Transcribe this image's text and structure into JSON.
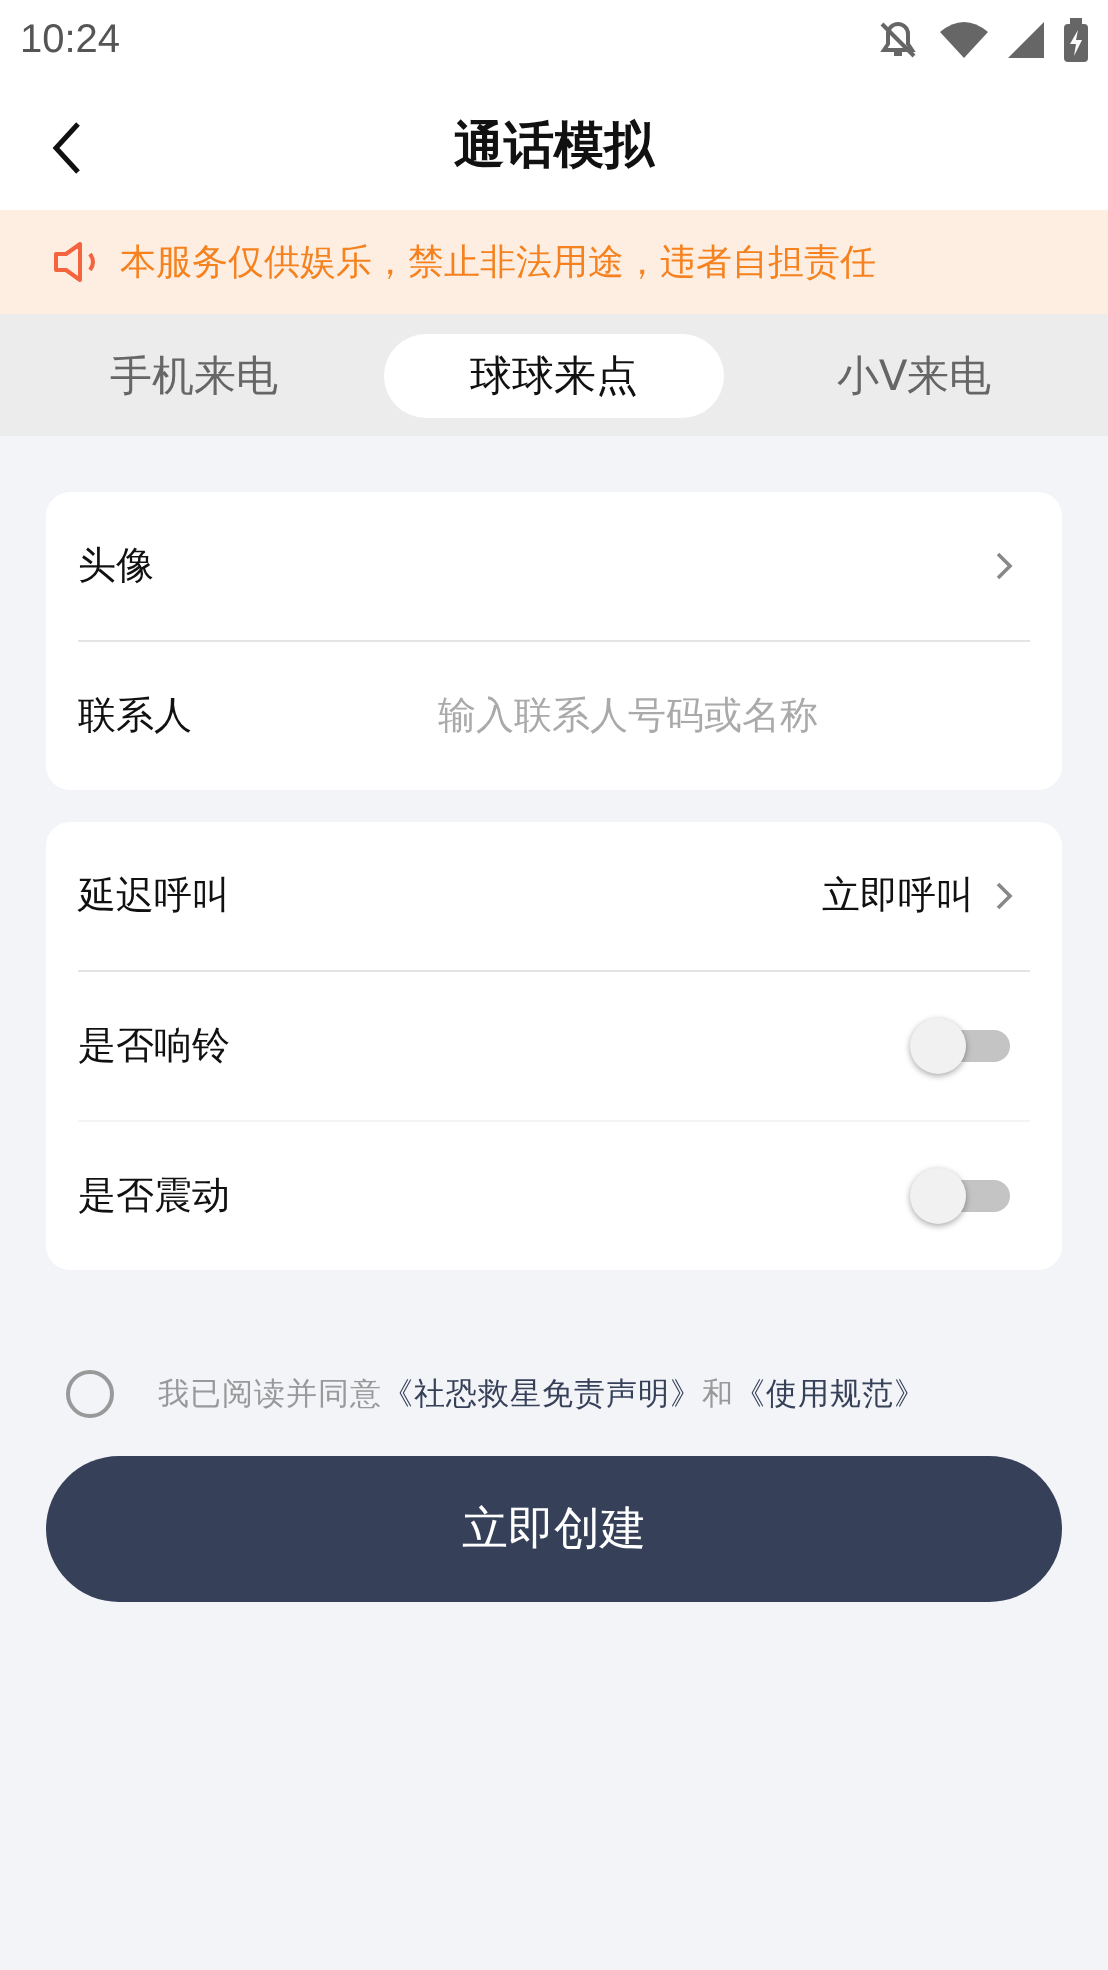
{
  "status_bar": {
    "time": "10:24"
  },
  "header": {
    "title": "通话模拟"
  },
  "notice": {
    "text": "本服务仅供娱乐，禁止非法用途，违者自担责任"
  },
  "tabs": [
    {
      "label": "手机来电",
      "selected": false
    },
    {
      "label": "球球来点",
      "selected": true
    },
    {
      "label": "小V来电",
      "selected": false
    }
  ],
  "cards": [
    {
      "rows": [
        {
          "kind": "link",
          "label": "头像"
        },
        {
          "kind": "input",
          "label": "联系人",
          "placeholder": "输入联系人号码或名称"
        }
      ]
    },
    {
      "rows": [
        {
          "kind": "link",
          "label": "延迟呼叫",
          "value": "立即呼叫"
        },
        {
          "kind": "switch",
          "label": "是否响铃",
          "on": false
        },
        {
          "kind": "switch",
          "label": "是否震动",
          "on": false
        }
      ]
    }
  ],
  "agreement": {
    "checked": false,
    "parts": [
      {
        "kind": "text",
        "text": "我已阅读并同意"
      },
      {
        "kind": "link",
        "text": "《社恐救星免责声明》"
      },
      {
        "kind": "text",
        "text": "和"
      },
      {
        "kind": "link",
        "text": "《使用规范》"
      }
    ]
  },
  "create_button": {
    "label": "立即创建"
  }
}
